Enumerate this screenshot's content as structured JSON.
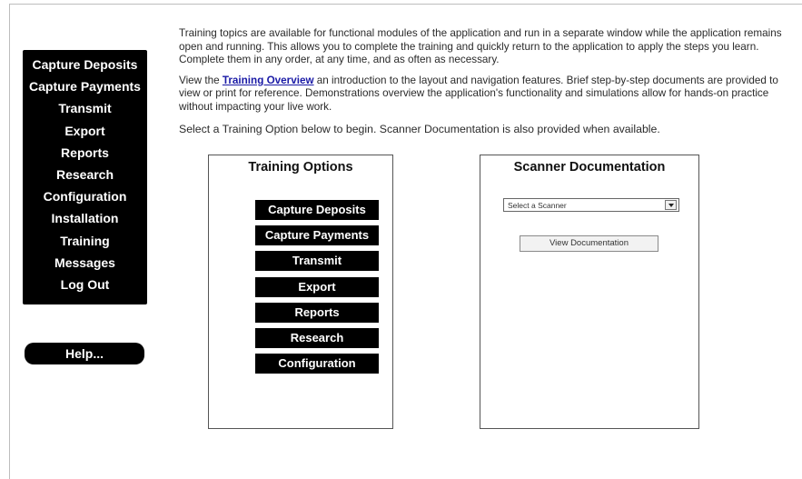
{
  "nav": {
    "items": [
      "Capture Deposits",
      "Capture Payments",
      "Transmit",
      "Export",
      "Reports",
      "Research",
      "Configuration",
      "Installation",
      "Training",
      "Messages",
      "Log Out"
    ],
    "help_label": "Help..."
  },
  "intro": {
    "para1": "Training topics are available for functional modules of the application and run in a separate window while the application remains open and running. This allows you to complete the training and quickly return to the application to apply the steps you learn. Complete them in any order, at any time, and as often as necessary.",
    "para2_prefix": "View the ",
    "para2_link": "Training Overview",
    "para2_suffix": " an introduction to the layout and navigation features. Brief step-by-step documents are provided to view or print for reference. Demonstrations overview the application's functionality and simulations allow for hands-on practice without impacting your live work.",
    "para3": "Select a Training Option below to begin. Scanner Documentation is also provided when available."
  },
  "training_options": {
    "title": "Training Options",
    "items": [
      "Capture Deposits",
      "Capture Payments",
      "Transmit",
      "Export",
      "Reports",
      "Research",
      "Configuration"
    ]
  },
  "scanner_docs": {
    "title": "Scanner Documentation",
    "select_value": "Select a Scanner",
    "view_button": "View Documentation"
  }
}
